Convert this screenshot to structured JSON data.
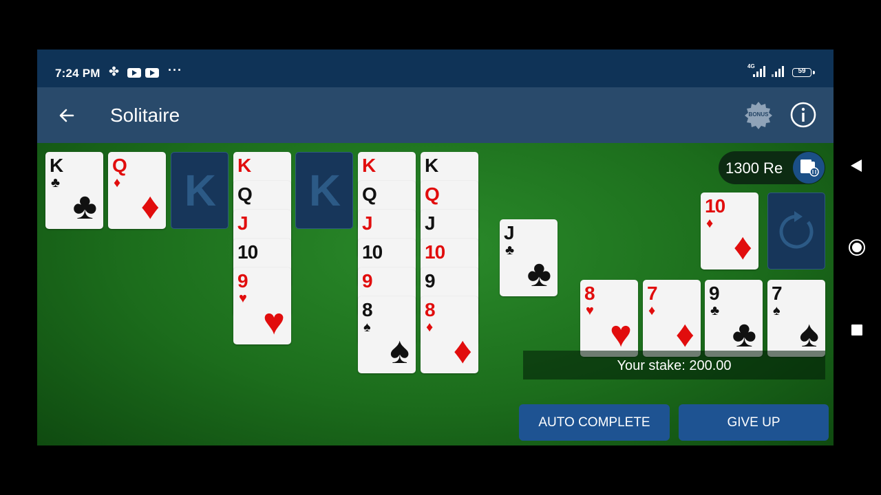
{
  "status_bar": {
    "time": "7:24 PM",
    "network": "4G",
    "battery": "59"
  },
  "app_bar": {
    "title": "Solitaire",
    "bonus_label": "BONUS"
  },
  "wallet": {
    "balance": "1300 Re"
  },
  "foundations": [
    {
      "rank": "K",
      "suit": "♣",
      "color": "black"
    },
    {
      "rank": "Q",
      "suit": "♦",
      "color": "red"
    },
    {
      "rank": "K",
      "suit": "",
      "color": "empty"
    },
    null,
    {
      "rank": "K",
      "suit": "",
      "color": "empty"
    }
  ],
  "tableau": {
    "col4": [
      {
        "rank": "K",
        "suit": "♦",
        "color": "red"
      },
      {
        "rank": "Q",
        "suit": "♠",
        "color": "black"
      },
      {
        "rank": "J",
        "suit": "♦",
        "color": "red"
      },
      {
        "rank": "10",
        "suit": "♣",
        "color": "black"
      },
      {
        "rank": "9",
        "suit": "♥",
        "color": "red"
      }
    ],
    "col6": [
      {
        "rank": "K",
        "suit": "♥",
        "color": "red"
      },
      {
        "rank": "Q",
        "suit": "♠",
        "color": "black"
      },
      {
        "rank": "J",
        "suit": "♥",
        "color": "red"
      },
      {
        "rank": "10",
        "suit": "♠",
        "color": "black"
      },
      {
        "rank": "9",
        "suit": "♦",
        "color": "red"
      },
      {
        "rank": "8",
        "suit": "♠",
        "color": "black"
      }
    ],
    "col7": [
      {
        "rank": "K",
        "suit": "♣",
        "color": "black"
      },
      {
        "rank": "Q",
        "suit": "♥",
        "color": "red"
      },
      {
        "rank": "J",
        "suit": "♣",
        "color": "black"
      },
      {
        "rank": "10",
        "suit": "♥",
        "color": "red"
      },
      {
        "rank": "9",
        "suit": "♣",
        "color": "black"
      },
      {
        "rank": "8",
        "suit": "♦",
        "color": "red"
      }
    ],
    "loose": {
      "rank": "J",
      "suit": "♣",
      "color": "black"
    }
  },
  "waste": {
    "rank": "10",
    "suit": "♦",
    "color": "red"
  },
  "bottom_row": [
    {
      "rank": "8",
      "suit": "♥",
      "color": "red"
    },
    {
      "rank": "7",
      "suit": "♦",
      "color": "red"
    },
    {
      "rank": "9",
      "suit": "♣",
      "color": "black"
    },
    {
      "rank": "7",
      "suit": "♠",
      "color": "black"
    }
  ],
  "stake": {
    "text": "Your stake: 200.00"
  },
  "buttons": {
    "auto_complete": "AUTO COMPLETE",
    "give_up": "GIVE UP"
  },
  "colors": {
    "red_suit": "#e10d0d",
    "black_suit": "#111111",
    "felt": "#1c6d1c",
    "header": "#294a6b",
    "button": "#1e5392"
  }
}
